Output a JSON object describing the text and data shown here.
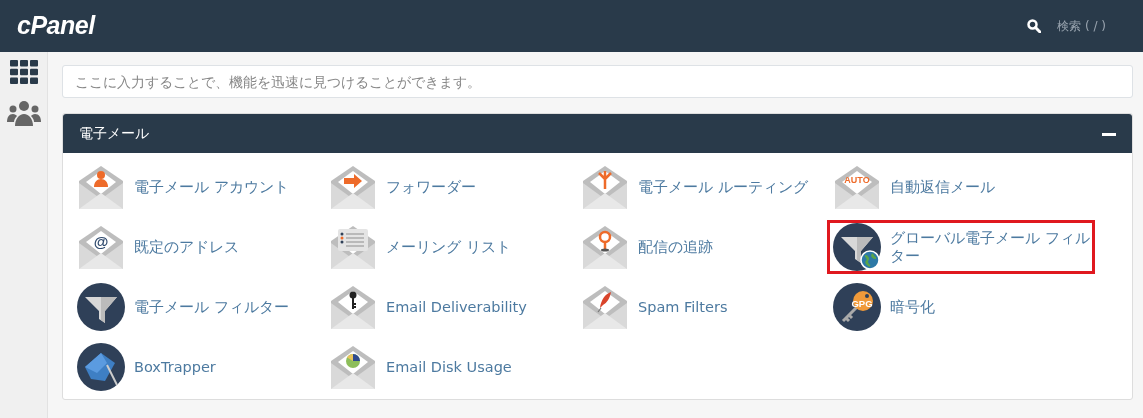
{
  "header": {
    "logo": "cPanel",
    "search_label": "検索 ( / )"
  },
  "search": {
    "placeholder": "ここに入力することで、機能を迅速に見つけることができます。"
  },
  "section": {
    "title": "電子メール",
    "expanded": true,
    "items": [
      {
        "label": "電子メール アカウント",
        "kind": "envelope",
        "highlighted": false
      },
      {
        "label": "フォワーダー",
        "kind": "envelope",
        "highlighted": false
      },
      {
        "label": "電子メール ルーティング",
        "kind": "envelope",
        "highlighted": false
      },
      {
        "label": "自動返信メール",
        "kind": "envelope",
        "highlighted": false,
        "badge": "AUTO"
      },
      {
        "label": "既定のアドレス",
        "kind": "envelope",
        "highlighted": false,
        "badge": "@"
      },
      {
        "label": "メーリング リスト",
        "kind": "envelope",
        "highlighted": false
      },
      {
        "label": "配信の追跡",
        "kind": "envelope",
        "highlighted": false
      },
      {
        "label": "グローバル電子メール フィルター",
        "kind": "round",
        "highlighted": true
      },
      {
        "label": "電子メール フィルター",
        "kind": "round",
        "highlighted": false
      },
      {
        "label": "Email Deliverability",
        "kind": "envelope",
        "highlighted": false
      },
      {
        "label": "Spam Filters",
        "kind": "envelope",
        "highlighted": false
      },
      {
        "label": "暗号化",
        "kind": "round",
        "highlighted": false,
        "badge": "GPG"
      },
      {
        "label": "BoxTrapper",
        "kind": "round",
        "highlighted": false
      },
      {
        "label": "Email Disk Usage",
        "kind": "envelope",
        "highlighted": false
      }
    ]
  }
}
